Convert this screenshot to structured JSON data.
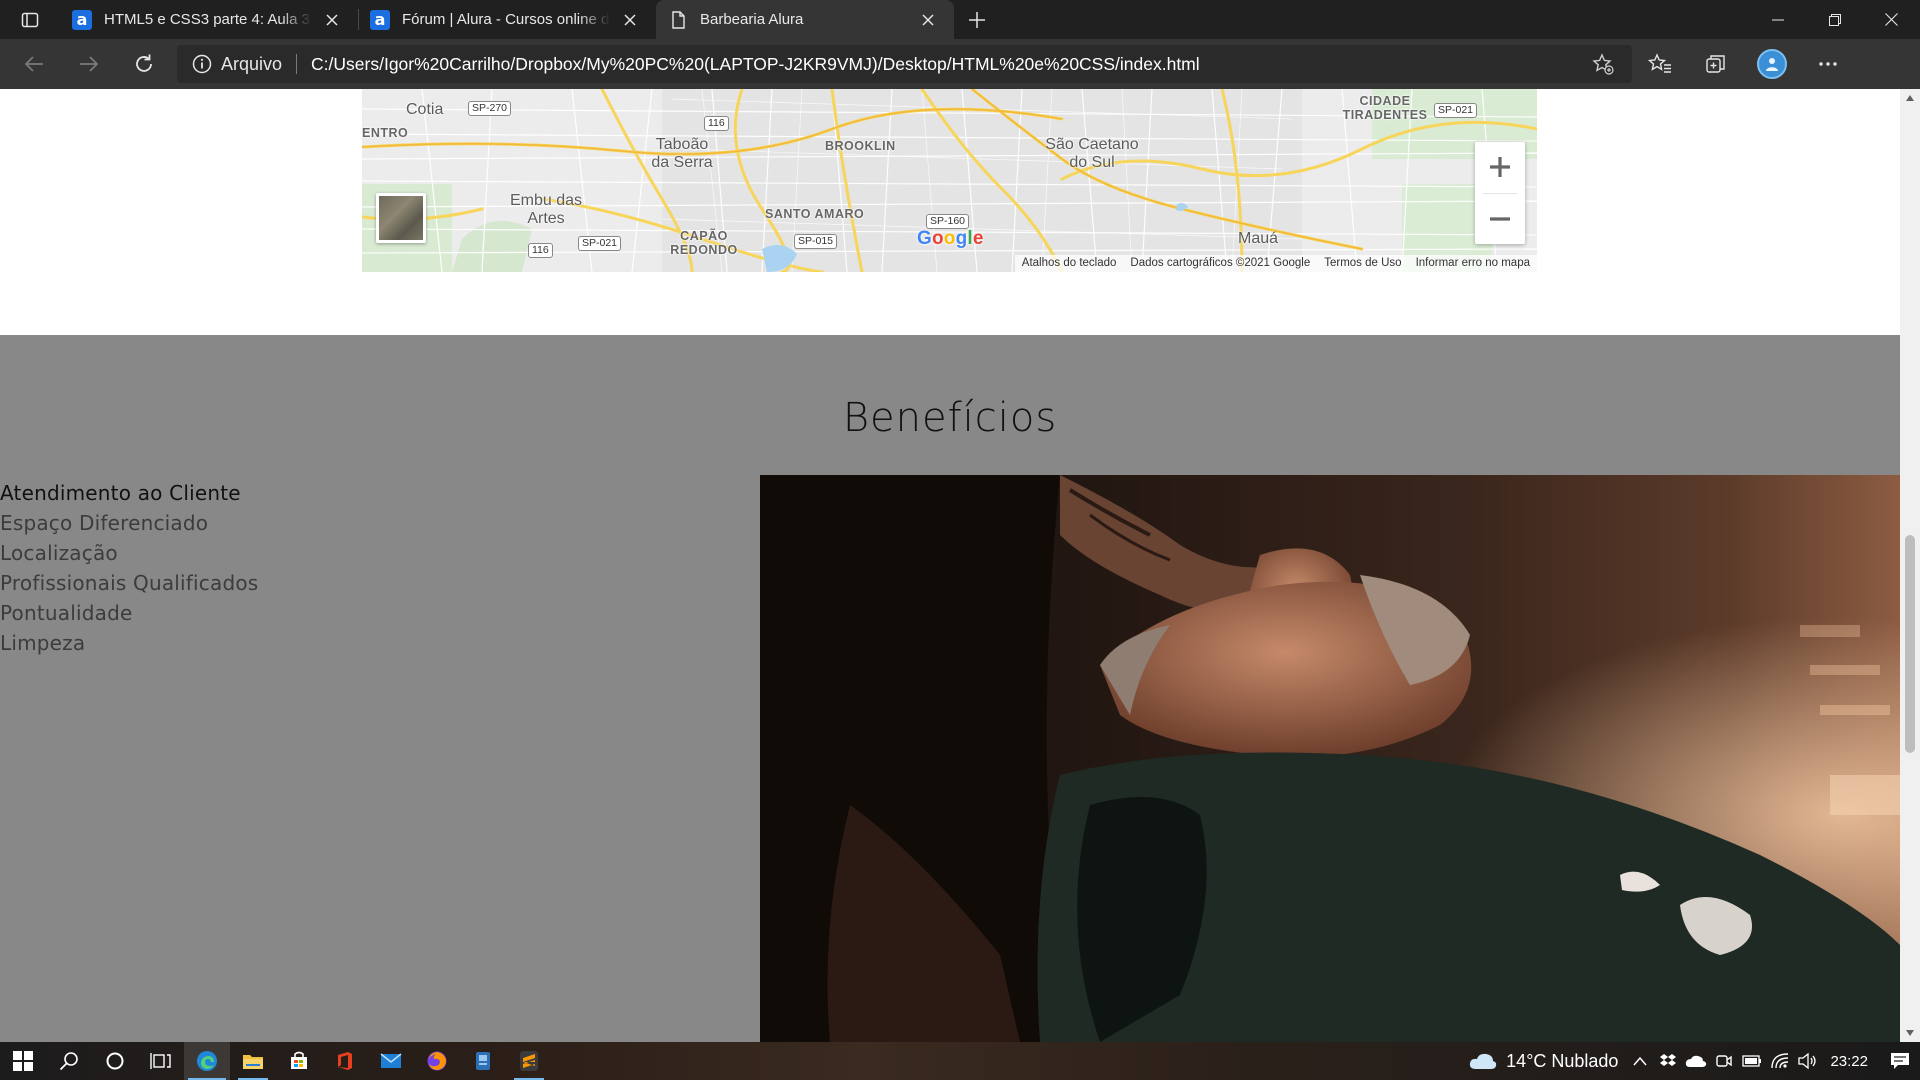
{
  "browser": {
    "tabs": [
      {
        "title": "HTML5 e CSS3 parte 4: Aula 3 - Atividade",
        "favicon": "alura-icon",
        "active": false
      },
      {
        "title": "Fórum | Alura - Cursos online de tecnologia",
        "favicon": "alura-icon",
        "active": false
      },
      {
        "title": "Barbearia Alura",
        "favicon": "page-icon",
        "active": true
      }
    ],
    "address": {
      "scheme_label": "Arquivo",
      "url": "C:/Users/Igor%20Carrilho/Dropbox/My%20PC%20(LAPTOP-J2KR9VMJ)/Desktop/HTML%20e%20CSS/index.html"
    }
  },
  "map": {
    "places": [
      "Cotia",
      "ENTRO",
      "Taboão da Serra",
      "BROOKLIN",
      "São Caetano do Sul",
      "CIDADE TIRADENTES",
      "Embu das Artes",
      "SANTO AMARO",
      "CAPÃO REDONDO",
      "Mauá"
    ],
    "shields": [
      "SP-270",
      "116",
      "SP-021",
      "116",
      "SP-021",
      "SP-015",
      "SP-160"
    ],
    "footer": [
      "Atalhos do teclado",
      "Dados cartográficos ©2021 Google",
      "Termos de Uso",
      "Informar erro no mapa"
    ],
    "zoom_in": "+",
    "zoom_out": "−"
  },
  "beneficios": {
    "title": "Benefícios",
    "items": [
      "Atendimento ao Cliente",
      "Espaço Diferenciado",
      "Localização",
      "Profissionais Qualificados",
      "Pontualidade",
      "Limpeza"
    ]
  },
  "taskbar": {
    "weather": "14°C  Nublado",
    "time": "23:22"
  },
  "colors": {
    "section_bg": "#888888",
    "browser_dark": "#202020",
    "toolbar": "#353535"
  }
}
